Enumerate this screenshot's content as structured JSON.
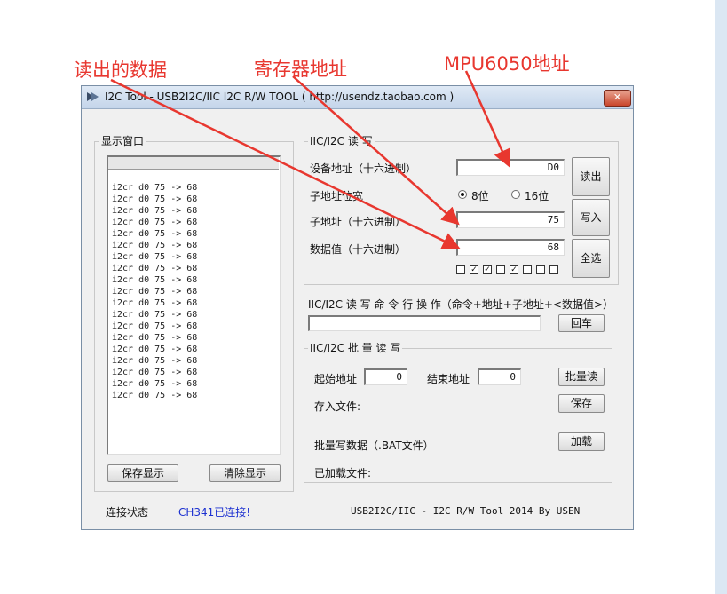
{
  "annotations": {
    "read_data": "读出的数据",
    "register_address": "寄存器地址",
    "device_address": "MPU6050地址"
  },
  "window": {
    "title": "I2C Tool  -  USB2I2C/IIC I2C R/W TOOL ( http://usendz.taobao.com )",
    "close_glyph": "✕"
  },
  "display": {
    "group_title": "显示窗口",
    "log_lines": [
      "i2cr d0 75 -> 68",
      "i2cr d0 75 -> 68",
      "i2cr d0 75 -> 68",
      "i2cr d0 75 -> 68",
      "i2cr d0 75 -> 68",
      "i2cr d0 75 -> 68",
      "i2cr d0 75 -> 68",
      "i2cr d0 75 -> 68",
      "i2cr d0 75 -> 68",
      "i2cr d0 75 -> 68",
      "i2cr d0 75 -> 68",
      "i2cr d0 75 -> 68",
      "i2cr d0 75 -> 68",
      "i2cr d0 75 -> 68",
      "i2cr d0 75 -> 68",
      "i2cr d0 75 -> 68",
      "i2cr d0 75 -> 68",
      "i2cr d0 75 -> 68",
      "i2cr d0 75 -> 68"
    ],
    "save_button": "保存显示",
    "clear_button": "清除显示"
  },
  "rw": {
    "group_title": "IIC/I2C 读 写",
    "device_addr_label": "设备地址（十六进制）",
    "device_addr_value": "D0",
    "subaddr_width_label": "子地址位宽",
    "opt_8bit": "8位",
    "opt_16bit": "16位",
    "selected_width": "8位",
    "subaddr_label": "子地址（十六进制）",
    "subaddr_value": "75",
    "data_label": "数据值（十六进制）",
    "data_value": "68",
    "read_button": "读出",
    "write_button": "写入",
    "select_all_button": "全选",
    "bit_checkboxes": [
      false,
      true,
      true,
      false,
      true,
      false,
      false,
      false
    ],
    "check_glyph": "✓"
  },
  "command": {
    "label": "IIC/I2C 读 写 命 令 行 操 作（命令+地址+子地址+<数据值>）",
    "input_value": "",
    "enter_button": "回车"
  },
  "batch": {
    "group_title": "IIC/I2C 批 量 读 写",
    "start_label": "起始地址",
    "start_value": "0",
    "end_label": "结束地址",
    "end_value": "0",
    "batch_read_button": "批量读",
    "save_file_label": "存入文件:",
    "save_button": "保存",
    "batch_write_label": "批量写数据（.BAT文件）",
    "load_button": "加载",
    "loaded_file_label": "已加载文件:"
  },
  "status": {
    "label": "连接状态",
    "value": "CH341已连接!",
    "credit": "USB2I2C/IIC - I2C R/W Tool 2014 By USEN"
  },
  "colors": {
    "annotation": "#e8372f",
    "status_value": "#1a2fd0"
  }
}
